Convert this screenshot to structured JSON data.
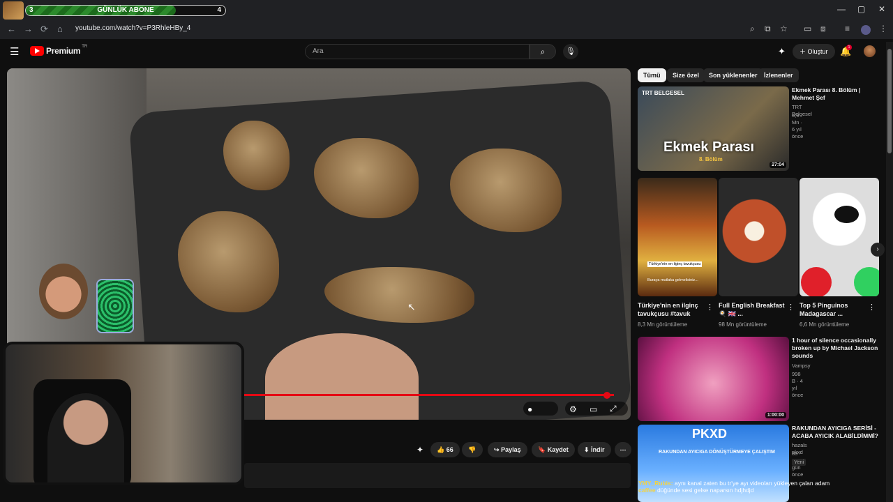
{
  "goal": {
    "current": "3",
    "title": "GÜNLÜK ABONE",
    "target": "4",
    "progress": 0.75
  },
  "window_controls": [
    "—",
    "▢",
    "✕"
  ],
  "url": "youtube.com/watch?v=P3RhleHBy_4",
  "header": {
    "logo_text": "Premium",
    "logo_region": "TR",
    "search_placeholder": "Ara",
    "create_label": "Oluştur",
    "notif_count": "1"
  },
  "player": {
    "cursor": "↖"
  },
  "actions": {
    "likes": "66",
    "share": "Paylaş",
    "save": "Kaydet",
    "download": "İndir"
  },
  "chips": [
    "Tümü",
    "Size özel",
    "Son yüklenenler",
    "İzlenenler"
  ],
  "recommendations": [
    {
      "title": "Ekmek Parası 8. Bölüm | Mehmet Şef",
      "channel": "TRT Belgesel",
      "meta": "6,9 Mn · 6 yıl önce",
      "duration": "27:04",
      "badge": "TRT BELGESEL",
      "overlay_title": "Ekmek Parası",
      "overlay_sub": "8. Bölüm"
    },
    {
      "title": "1 hour of silence occasionally broken up by Michael Jackson sounds",
      "channel": "Vampsy",
      "meta": "998 B · 4 yıl önce",
      "duration": "1:00:00"
    },
    {
      "title": "RAKUNDAN AYICIGA SERİSİ - ACABA AYICIK ALABİLDİMMİ?",
      "channel": "hazals pkxd",
      "meta": "63 · 1 gün önce",
      "badge": "Yeni",
      "overlay_title": "PKXD",
      "overlay_sub": "RAKUNDAN AYICIGA DÖNÜŞTÜRMEYE ÇALIŞTIM"
    }
  ],
  "shorts": [
    {
      "title": "Türkiye'nin en ilginç tavukçusu #tavuk",
      "views": "8,3 Mn görüntüleme",
      "caption": "Türkiye'nin en ilginç tavukçusu",
      "caption2": "Buraya mutlaka gelmelisiniz..."
    },
    {
      "title": "Full English Breakfast 🍳 🇬🇧 ...",
      "views": "98 Mn görüntüleme"
    },
    {
      "title": "Top 5 Pinguinos Madagascar ...",
      "views": "6,6 Mn görüntüleme"
    }
  ],
  "chat_message": {
    "user": "YMY_Rubis:",
    "text": "aynı kanal zaten bu tr'ye ayı videoları yükleyen çalan adam",
    "user2": "caffee",
    "text2": "düğünde sesi gelse naparsın hdjhdjd"
  },
  "colors": {
    "accent": "#ff0000",
    "progress": "#e50914",
    "goal_fill": "#2c8a2c"
  }
}
